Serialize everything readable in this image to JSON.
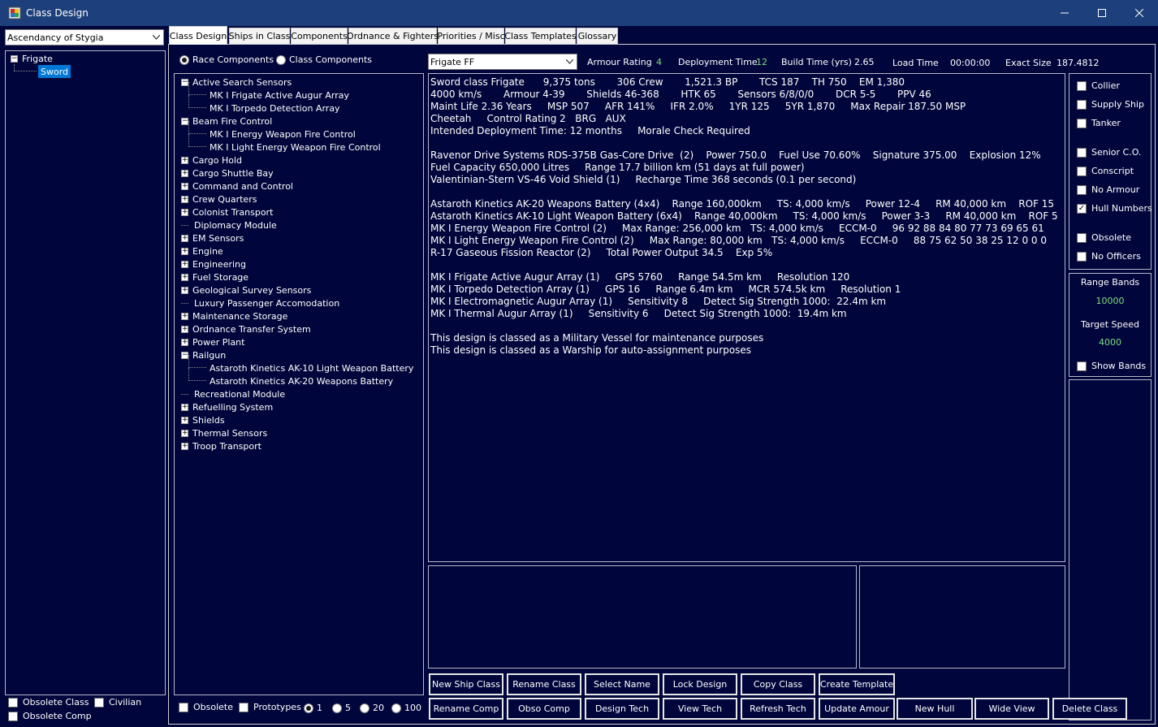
{
  "window": {
    "title": "Class Design"
  },
  "race_select": {
    "value": "Ascendancy of Stygia"
  },
  "left_tree": {
    "root": "Frigate",
    "child": "Sword"
  },
  "left_bottom": {
    "obsolete_class": "Obsolete Class",
    "civilian": "Civilian",
    "obsolete_comp": "Obsolete Comp"
  },
  "tabs": [
    "Class Design",
    "Ships in Class",
    "Components",
    "Ordnance & Fighters",
    "Priorities / Misc",
    "Class Templates",
    "Glossary"
  ],
  "component_filter": {
    "race": "Race Components",
    "class": "Class Components"
  },
  "component_tree": [
    {
      "label": "Active Search Sensors",
      "expanded": true
    },
    {
      "label": "MK I Frigate Active Augur Array",
      "child": true
    },
    {
      "label": "MK I Torpedo Detection Array",
      "child": true
    },
    {
      "label": "Beam Fire Control",
      "expanded": true
    },
    {
      "label": "MK I Energy Weapon Fire Control",
      "child": true
    },
    {
      "label": "MK I Light Energy Weapon Fire Control",
      "child": true
    },
    {
      "label": "Cargo Hold"
    },
    {
      "label": "Cargo Shuttle Bay"
    },
    {
      "label": "Command and Control"
    },
    {
      "label": "Crew Quarters"
    },
    {
      "label": "Colonist Transport"
    },
    {
      "label": "Diplomacy Module",
      "leaf": true
    },
    {
      "label": "EM Sensors"
    },
    {
      "label": "Engine"
    },
    {
      "label": "Engineering"
    },
    {
      "label": "Fuel Storage"
    },
    {
      "label": "Geological Survey Sensors"
    },
    {
      "label": "Luxury Passenger Accomodation",
      "leaf": true
    },
    {
      "label": "Maintenance Storage"
    },
    {
      "label": "Ordnance Transfer System"
    },
    {
      "label": "Power Plant"
    },
    {
      "label": "Railgun",
      "expanded": true
    },
    {
      "label": "Astaroth Kinetics AK-10 Light Weapon Battery",
      "child": true
    },
    {
      "label": "Astaroth Kinetics AK-20 Weapons Battery",
      "child": true
    },
    {
      "label": "Recreational Module",
      "leaf": true
    },
    {
      "label": "Refuelling System"
    },
    {
      "label": "Shields"
    },
    {
      "label": "Thermal Sensors"
    },
    {
      "label": "Troop Transport"
    }
  ],
  "tree_bottom": {
    "obsolete": "Obsolete",
    "prototypes": "Prototypes",
    "steps": [
      "1",
      "5",
      "20",
      "100"
    ]
  },
  "class_select": {
    "value": "Frigate  FF"
  },
  "header": {
    "armour_label": "Armour Rating",
    "armour_value": "4",
    "deploy_label": "Deployment Time",
    "deploy_value": "12",
    "build_label": "Build Time (yrs)",
    "build_value": "2.65",
    "load_label": "Load Time",
    "load_value": "00:00:00",
    "size_label": "Exact Size",
    "size_value": "187.4812"
  },
  "summary": [
    "Sword class Frigate      9,375 tons       306 Crew       1,521.3 BP       TCS 187    TH 750    EM 1,380",
    "4000 km/s       Armour 4-39       Shields 46-368       HTK 65       Sensors 6/8/0/0       DCR 5-5       PPV 46",
    "Maint Life 2.36 Years     MSP 507     AFR 141%     IFR 2.0%     1YR 125     5YR 1,870     Max Repair 187.50 MSP",
    "Cheetah     Control Rating 2   BRG   AUX",
    "Intended Deployment Time: 12 months     Morale Check Required",
    "",
    "Ravenor Drive Systems RDS-375B Gas-Core Drive  (2)    Power 750.0    Fuel Use 70.60%    Signature 375.00    Explosion 12%",
    "Fuel Capacity 650,000 Litres     Range 17.7 billion km (51 days at full power)",
    "Valentinian-Stern VS-46 Void Shield (1)     Recharge Time 368 seconds (0.1 per second)",
    "",
    "Astaroth Kinetics AK-20 Weapons Battery (4x4)    Range 160,000km     TS: 4,000 km/s     Power 12-4     RM 40,000 km    ROF 15",
    "Astaroth Kinetics AK-10 Light Weapon Battery (6x4)    Range 40,000km     TS: 4,000 km/s     Power 3-3     RM 40,000 km    ROF 5",
    "MK I Energy Weapon Fire Control (2)     Max Range: 256,000 km   TS: 4,000 km/s     ECCM-0     96 92 88 84 80 77 73 69 65 61",
    "MK I Light Energy Weapon Fire Control (2)     Max Range: 80,000 km   TS: 4,000 km/s     ECCM-0     88 75 62 50 38 25 12 0 0 0",
    "R-17 Gaseous Fission Reactor (2)     Total Power Output 34.5    Exp 5%",
    "",
    "MK I Frigate Active Augur Array (1)     GPS 5760     Range 54.5m km     Resolution 120",
    "MK I Torpedo Detection Array (1)     GPS 16     Range 6.4m km     MCR 574.5k km     Resolution 1",
    "MK I Electromagnetic Augur Array (1)     Sensitivity 8     Detect Sig Strength 1000:  22.4m km",
    "MK I Thermal Augur Array (1)     Sensitivity 6     Detect Sig Strength 1000:  19.4m km",
    "",
    "This design is classed as a Military Vessel for maintenance purposes",
    "This design is classed as a Warship for auto-assignment purposes"
  ],
  "options": [
    {
      "label": "Collier",
      "checked": false
    },
    {
      "label": "Supply Ship",
      "checked": false
    },
    {
      "label": "Tanker",
      "checked": false
    },
    {
      "label": "Senior C.O.",
      "checked": false
    },
    {
      "label": "Conscript",
      "checked": false
    },
    {
      "label": "No Armour",
      "checked": false
    },
    {
      "label": "Hull Numbers",
      "checked": true
    },
    {
      "label": "Obsolete",
      "checked": false
    },
    {
      "label": "No Officers",
      "checked": false
    }
  ],
  "range_panel": {
    "range_label": "Range Bands",
    "range_value": "10000",
    "speed_label": "Target Speed",
    "speed_value": "4000",
    "show_bands": "Show Bands"
  },
  "buttons_row1": [
    "New Ship Class",
    "Rename Class",
    "Select Name",
    "Lock Design",
    "Copy Class",
    "Create Template"
  ],
  "buttons_row2": [
    "Rename Comp",
    "Obso Comp",
    "Design Tech",
    "View Tech",
    "Refresh Tech",
    "Update Amour",
    "New Hull",
    "Wide View",
    "Delete Class"
  ]
}
